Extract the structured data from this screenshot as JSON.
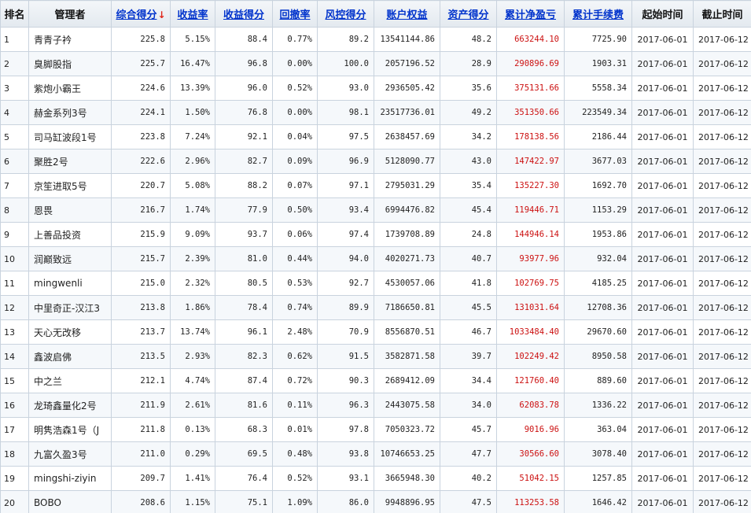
{
  "columns": [
    {
      "label": "排名",
      "sortable": false
    },
    {
      "label": "管理者",
      "sortable": false
    },
    {
      "label": "综合得分",
      "sortable": true,
      "sorted": true
    },
    {
      "label": "收益率",
      "sortable": true
    },
    {
      "label": "收益得分",
      "sortable": true
    },
    {
      "label": "回撤率",
      "sortable": true
    },
    {
      "label": "风控得分",
      "sortable": true
    },
    {
      "label": "账户权益",
      "sortable": true
    },
    {
      "label": "资产得分",
      "sortable": true
    },
    {
      "label": "累计净盈亏",
      "sortable": true
    },
    {
      "label": "累计手续费",
      "sortable": true
    },
    {
      "label": "起始时间",
      "sortable": false
    },
    {
      "label": "截止时间",
      "sortable": false
    }
  ],
  "sort_indicator": "arrow-down-icon",
  "accent_colors": {
    "link": "#0033cc",
    "profit": "#cc1111",
    "sort_arrow": "#e0261a"
  },
  "rows": [
    [
      "1",
      "青青子衿",
      "225.8",
      "5.15%",
      "88.4",
      "0.77%",
      "89.2",
      "13541144.86",
      "48.2",
      "663244.10",
      "7725.90",
      "2017-06-01",
      "2017-06-12"
    ],
    [
      "2",
      "臭脚股指",
      "225.7",
      "16.47%",
      "96.8",
      "0.00%",
      "100.0",
      "2057196.52",
      "28.9",
      "290896.69",
      "1903.31",
      "2017-06-01",
      "2017-06-12"
    ],
    [
      "3",
      "紫炮小霸王",
      "224.6",
      "13.39%",
      "96.0",
      "0.52%",
      "93.0",
      "2936505.42",
      "35.6",
      "375131.66",
      "5558.34",
      "2017-06-01",
      "2017-06-12"
    ],
    [
      "4",
      "赫金系列3号",
      "224.1",
      "1.50%",
      "76.8",
      "0.00%",
      "98.1",
      "23517736.01",
      "49.2",
      "351350.66",
      "223549.34",
      "2017-06-01",
      "2017-06-12"
    ],
    [
      "5",
      "司马缸波段1号",
      "223.8",
      "7.24%",
      "92.1",
      "0.04%",
      "97.5",
      "2638457.69",
      "34.2",
      "178138.56",
      "2186.44",
      "2017-06-01",
      "2017-06-12"
    ],
    [
      "6",
      "聚胜2号",
      "222.6",
      "2.96%",
      "82.7",
      "0.09%",
      "96.9",
      "5128090.77",
      "43.0",
      "147422.97",
      "3677.03",
      "2017-06-01",
      "2017-06-12"
    ],
    [
      "7",
      "京笙进取5号",
      "220.7",
      "5.08%",
      "88.2",
      "0.07%",
      "97.1",
      "2795031.29",
      "35.4",
      "135227.30",
      "1692.70",
      "2017-06-01",
      "2017-06-12"
    ],
    [
      "8",
      "恩畏",
      "216.7",
      "1.74%",
      "77.9",
      "0.50%",
      "93.4",
      "6994476.82",
      "45.4",
      "119446.71",
      "1153.29",
      "2017-06-01",
      "2017-06-12"
    ],
    [
      "9",
      "上善品投资",
      "215.9",
      "9.09%",
      "93.7",
      "0.06%",
      "97.4",
      "1739708.89",
      "24.8",
      "144946.14",
      "1953.86",
      "2017-06-01",
      "2017-06-12"
    ],
    [
      "10",
      "润巅致远",
      "215.7",
      "2.39%",
      "81.0",
      "0.44%",
      "94.0",
      "4020271.73",
      "40.7",
      "93977.96",
      "932.04",
      "2017-06-01",
      "2017-06-12"
    ],
    [
      "11",
      "mingwenli",
      "215.0",
      "2.32%",
      "80.5",
      "0.53%",
      "92.7",
      "4530057.06",
      "41.8",
      "102769.75",
      "4185.25",
      "2017-06-01",
      "2017-06-12"
    ],
    [
      "12",
      "中里奇正-汉江3",
      "213.8",
      "1.86%",
      "78.4",
      "0.74%",
      "89.9",
      "7186650.81",
      "45.5",
      "131031.64",
      "12708.36",
      "2017-06-01",
      "2017-06-12"
    ],
    [
      "13",
      "天心无改移",
      "213.7",
      "13.74%",
      "96.1",
      "2.48%",
      "70.9",
      "8556870.51",
      "46.7",
      "1033484.40",
      "29670.60",
      "2017-06-01",
      "2017-06-12"
    ],
    [
      "14",
      "鑫波启佛",
      "213.5",
      "2.93%",
      "82.3",
      "0.62%",
      "91.5",
      "3582871.58",
      "39.7",
      "102249.42",
      "8950.58",
      "2017-06-01",
      "2017-06-12"
    ],
    [
      "15",
      "中之兰",
      "212.1",
      "4.74%",
      "87.4",
      "0.72%",
      "90.3",
      "2689412.09",
      "34.4",
      "121760.40",
      "889.60",
      "2017-06-01",
      "2017-06-12"
    ],
    [
      "16",
      "龙琦鑫量化2号",
      "211.9",
      "2.61%",
      "81.6",
      "0.11%",
      "96.3",
      "2443075.58",
      "34.0",
      "62083.78",
      "1336.22",
      "2017-06-01",
      "2017-06-12"
    ],
    [
      "17",
      "明隽浩森1号（J",
      "211.8",
      "0.13%",
      "68.3",
      "0.01%",
      "97.8",
      "7050323.72",
      "45.7",
      "9016.96",
      "363.04",
      "2017-06-01",
      "2017-06-12"
    ],
    [
      "18",
      "九富久盈3号",
      "211.0",
      "0.29%",
      "69.5",
      "0.48%",
      "93.8",
      "10746653.25",
      "47.7",
      "30566.60",
      "3078.40",
      "2017-06-01",
      "2017-06-12"
    ],
    [
      "19",
      "mingshi-ziyin",
      "209.7",
      "1.41%",
      "76.4",
      "0.52%",
      "93.1",
      "3665948.30",
      "40.2",
      "51042.15",
      "1257.85",
      "2017-06-01",
      "2017-06-12"
    ],
    [
      "20",
      "BOBO",
      "208.6",
      "1.15%",
      "75.1",
      "1.09%",
      "86.0",
      "9948896.95",
      "47.5",
      "113253.58",
      "1646.42",
      "2017-06-01",
      "2017-06-12"
    ]
  ]
}
